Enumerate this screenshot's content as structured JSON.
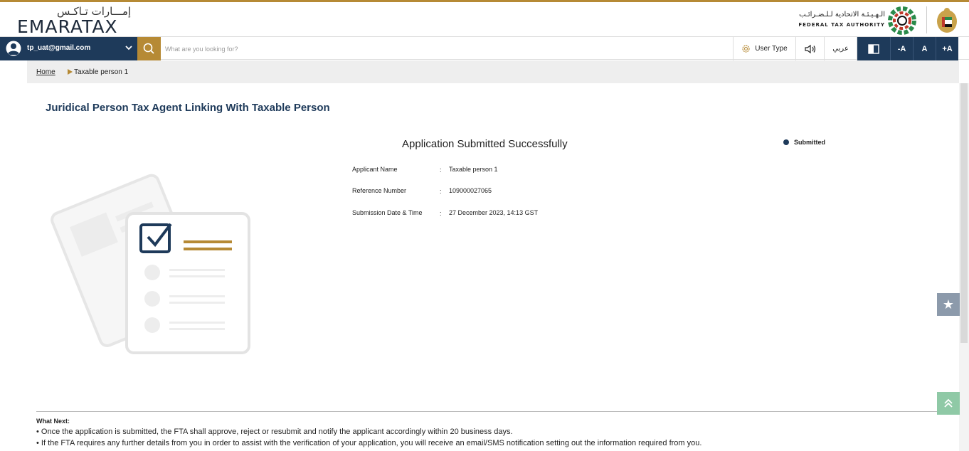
{
  "header": {
    "logo_arabic": "إمـــارات تـاكـس",
    "logo_english": "EMARATAX",
    "fta_arabic": "الـهـيـئـة الاتحادية لـلـضـرائـب",
    "fta_english": "FEDERAL TAX AUTHORITY"
  },
  "navbar": {
    "user_email": "tp_uat@gmail.com",
    "search_placeholder": "What are you looking for?",
    "user_type_label": "User Type",
    "arabic_label": "عربي",
    "font_decrease": "-A",
    "font_reset": "A",
    "font_increase": "+A"
  },
  "breadcrumb": {
    "home": "Home",
    "current": "Taxable person 1"
  },
  "main": {
    "page_title": "Juridical Person Tax Agent Linking With Taxable Person",
    "success_title": "Application Submitted Successfully",
    "status": "Submitted",
    "details": [
      {
        "label": "Applicant Name",
        "value": "Taxable person 1"
      },
      {
        "label": "Reference Number",
        "value": "109000027065"
      },
      {
        "label": "Submission Date & Time",
        "value": "27 December 2023, 14:13 GST"
      }
    ]
  },
  "what_next": {
    "heading": "What Next:",
    "line1": "• Once the application is submitted, the FTA shall approve, reject or resubmit and notify the applicant accordingly within 20 business days.",
    "line2": "• If the FTA requires any further details from you in order to assist with the verification of your application, you will receive an email/SMS notification setting out the information required from you."
  },
  "colors": {
    "brand_gold": "#b68a35",
    "brand_navy": "#1e3a5a",
    "scroll_top_green": "#8fc9a6"
  },
  "icons": [
    "user-avatar-icon",
    "chevron-down-icon",
    "search-icon",
    "gear-icon",
    "speaker-icon",
    "contrast-icon",
    "star-icon",
    "double-chevron-up-icon"
  ]
}
